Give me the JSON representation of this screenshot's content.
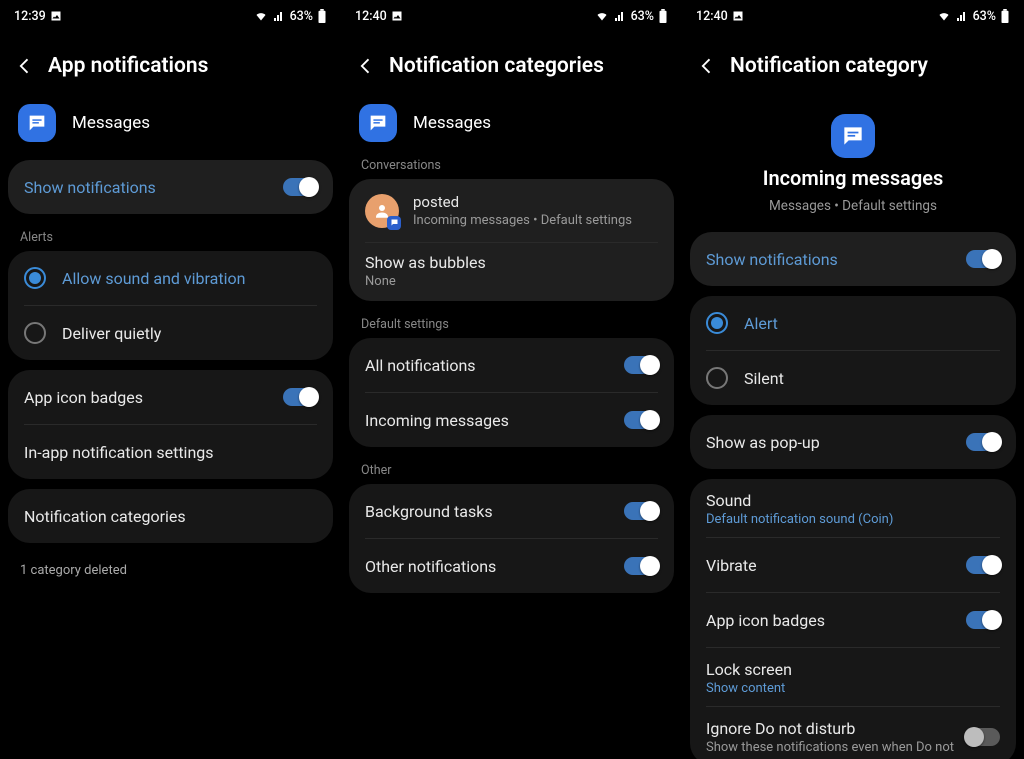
{
  "status": {
    "batt_text": "63%",
    "image_icon": "▢"
  },
  "p1": {
    "time": "12:39",
    "title": "App notifications",
    "app": "Messages",
    "show_notifications": "Show notifications",
    "section_alerts": "Alerts",
    "allow_sound": "Allow sound and vibration",
    "deliver_quietly": "Deliver quietly",
    "app_icon_badges": "App icon badges",
    "in_app": "In-app notification settings",
    "categories": "Notification categories",
    "footer": "1 category deleted"
  },
  "p2": {
    "time": "12:40",
    "title": "Notification categories",
    "app": "Messages",
    "section_conv": "Conversations",
    "conv_name": "posted",
    "conv_sub": "Incoming messages • Default settings",
    "bubbles": "Show as bubbles",
    "bubbles_sub": "None",
    "section_defaults": "Default settings",
    "all_notifications": "All notifications",
    "incoming": "Incoming messages",
    "section_other": "Other",
    "background_tasks": "Background tasks",
    "other_notifications": "Other notifications"
  },
  "p3": {
    "time": "12:40",
    "title": "Notification category",
    "center_title": "Incoming messages",
    "center_sub": "Messages • Default settings",
    "show_notifications": "Show notifications",
    "alert": "Alert",
    "silent": "Silent",
    "popup": "Show as pop-up",
    "sound": "Sound",
    "sound_sub": "Default notification sound (Coin)",
    "vibrate": "Vibrate",
    "badges": "App icon badges",
    "lock": "Lock screen",
    "lock_sub": "Show content",
    "dnd": "Ignore Do not disturb",
    "dnd_sub": "Show these notifications even when Do not"
  }
}
